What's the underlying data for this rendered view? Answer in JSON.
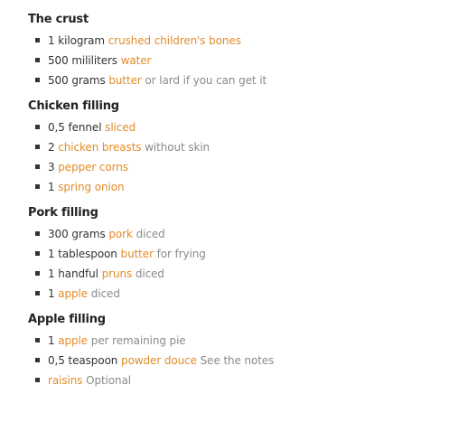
{
  "colors": {
    "ingredient_link": "#e38c2a",
    "notes": "#8a8a8a",
    "text": "#333333",
    "heading": "#222222"
  },
  "groups": [
    {
      "title": "The crust",
      "items": [
        {
          "amount": "1",
          "unit": "kilogram",
          "name": "crushed children's bones",
          "notes": ""
        },
        {
          "amount": "500",
          "unit": "mililiters",
          "name": "water",
          "notes": ""
        },
        {
          "amount": "500",
          "unit": "grams",
          "name": "butter",
          "notes": "or lard if you can get it"
        }
      ]
    },
    {
      "title": "Chicken filling",
      "items": [
        {
          "amount": "0,5",
          "unit": "fennel",
          "name": "sliced",
          "notes": ""
        },
        {
          "amount": "2",
          "unit": "",
          "name": "chicken breasts",
          "notes": "without skin"
        },
        {
          "amount": "3",
          "unit": "",
          "name": "pepper corns",
          "notes": ""
        },
        {
          "amount": "1",
          "unit": "",
          "name": "spring onion",
          "notes": ""
        }
      ]
    },
    {
      "title": "Pork filling",
      "items": [
        {
          "amount": "300",
          "unit": "grams",
          "name": "pork",
          "notes": "diced"
        },
        {
          "amount": "1",
          "unit": "tablespoon",
          "name": "butter",
          "notes": "for frying"
        },
        {
          "amount": "1",
          "unit": "handful",
          "name": "pruns",
          "notes": "diced"
        },
        {
          "amount": "1",
          "unit": "",
          "name": "apple",
          "notes": "diced"
        }
      ]
    },
    {
      "title": "Apple filling",
      "items": [
        {
          "amount": "1",
          "unit": "",
          "name": "apple",
          "notes": "per remaining pie"
        },
        {
          "amount": "0,5",
          "unit": "teaspoon",
          "name": "powder douce",
          "notes": "See the notes"
        },
        {
          "amount": "",
          "unit": "",
          "name": "raisins",
          "notes": "Optional"
        }
      ]
    }
  ]
}
